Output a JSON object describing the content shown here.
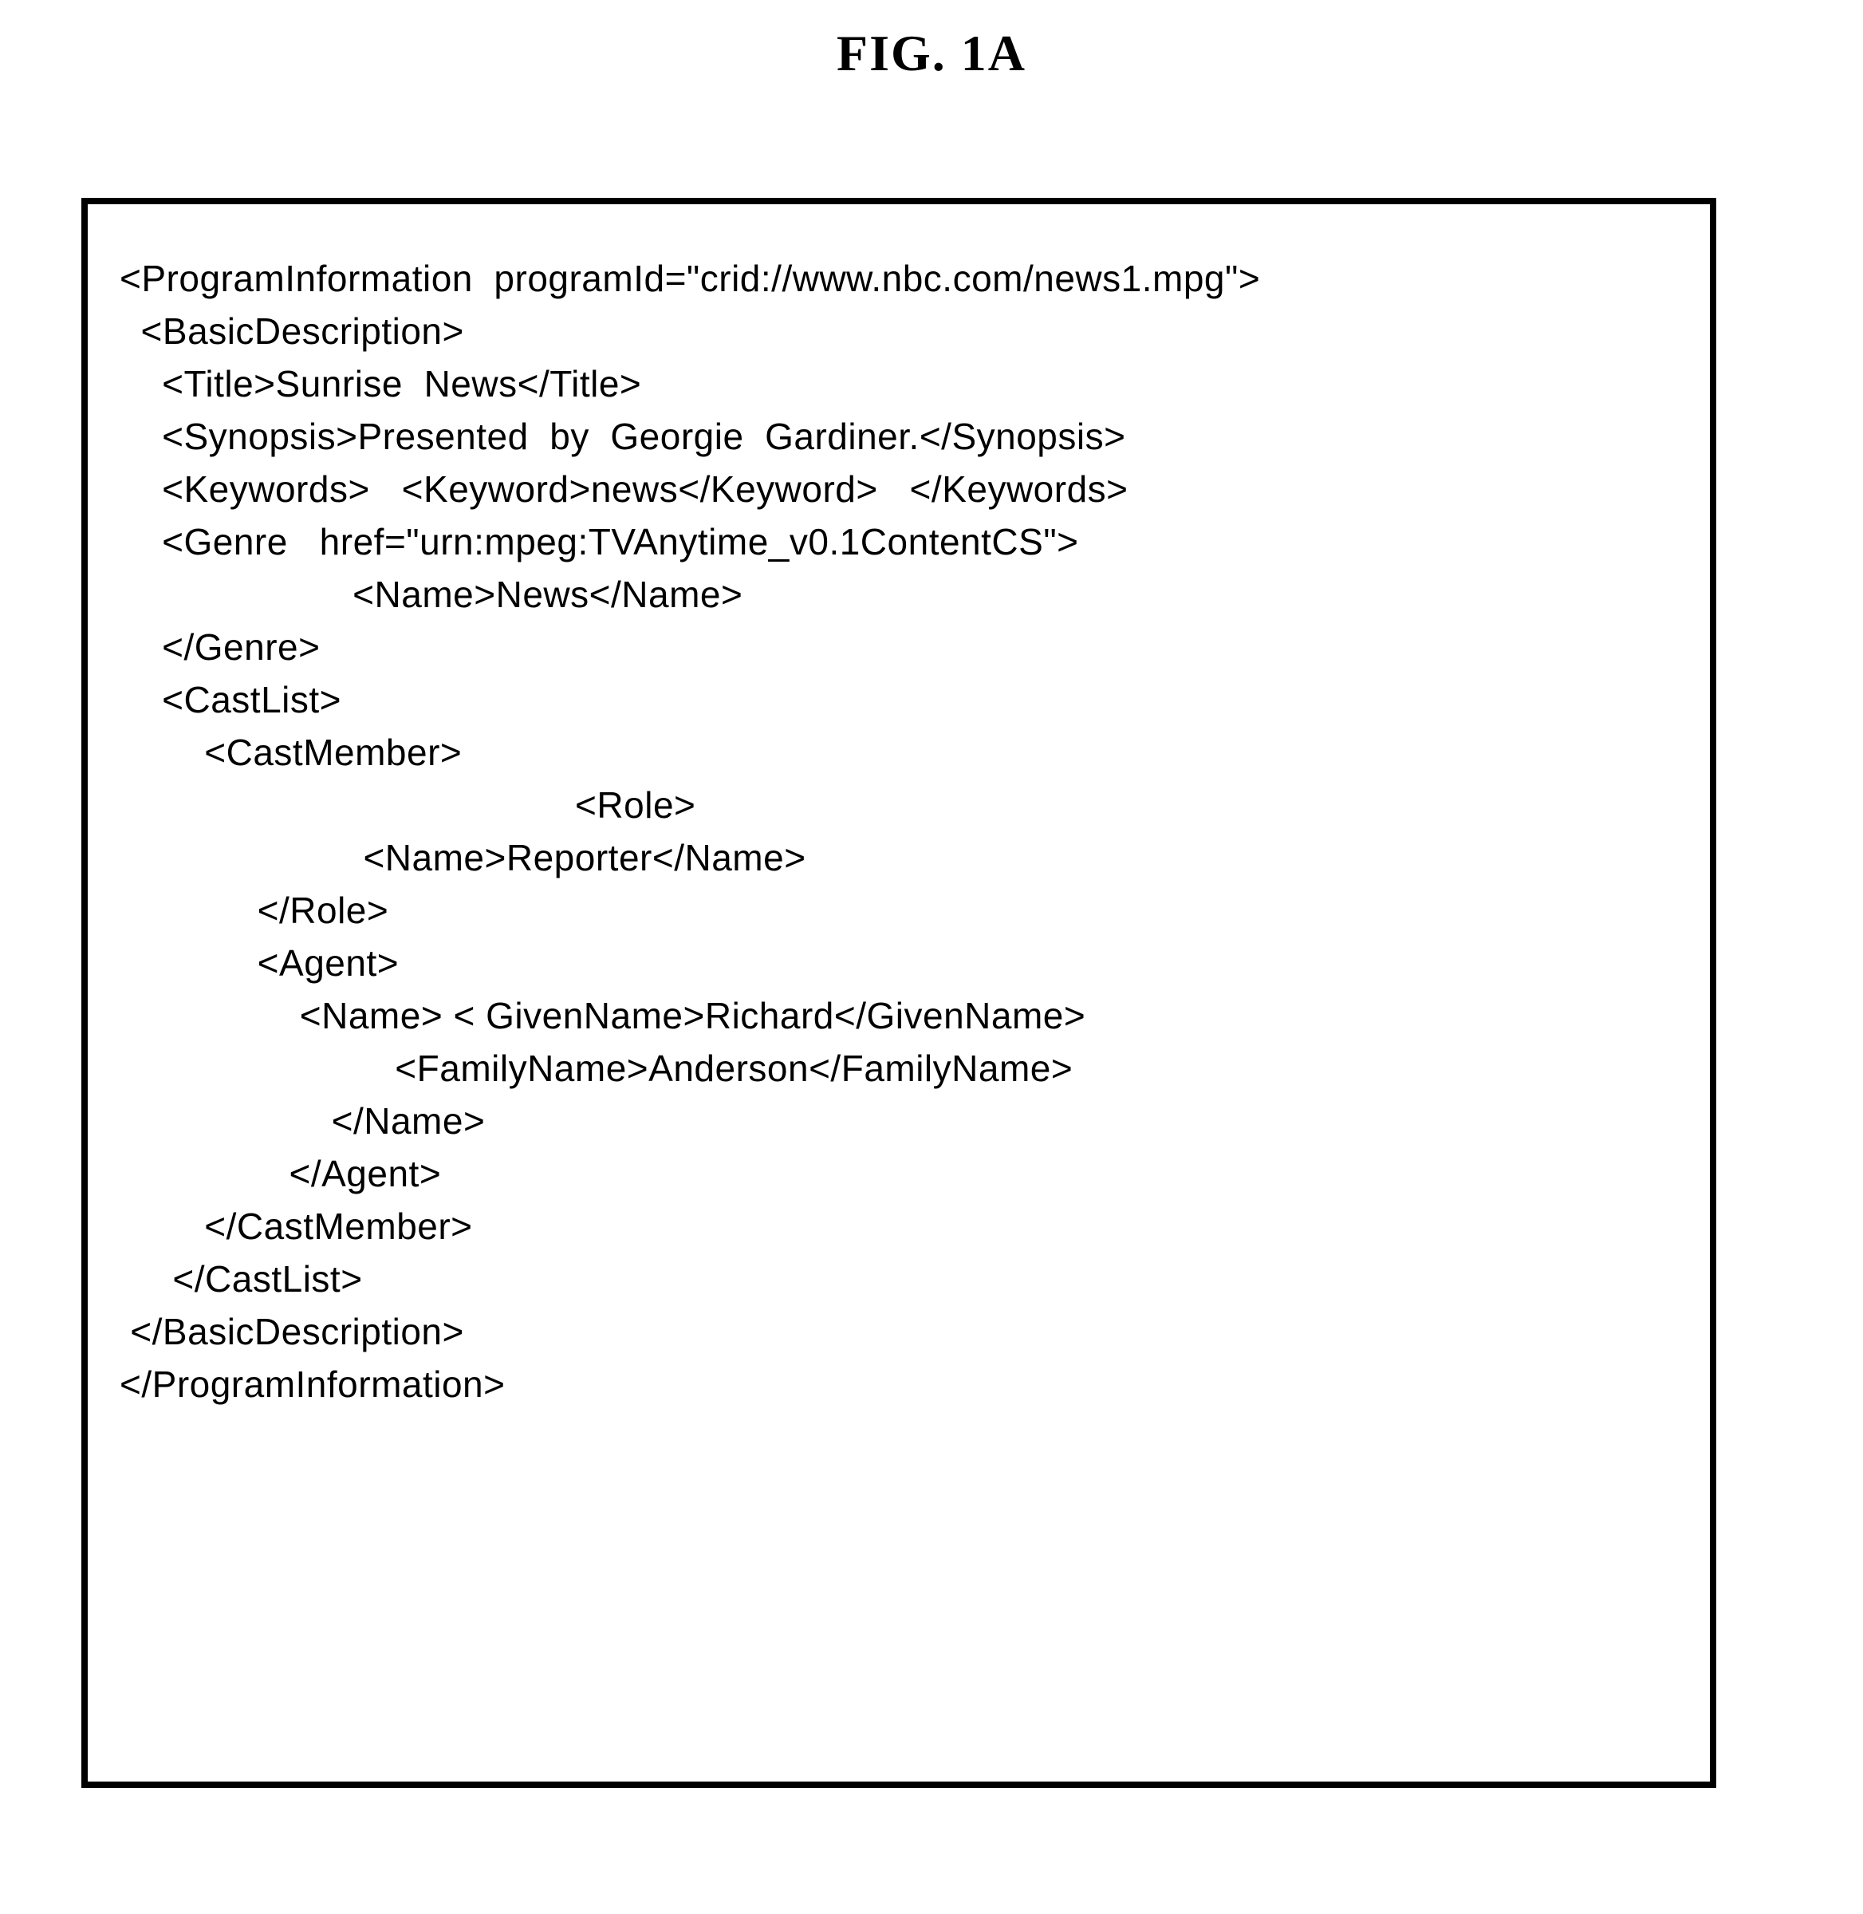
{
  "figure_label": "FIG.  1A",
  "code_lines": [
    "<ProgramInformation  programId=\"crid://www.nbc.com/news1.mpg\">",
    "  <BasicDescription>",
    "    <Title>Sunrise  News</Title>",
    "    <Synopsis>Presented  by  Georgie  Gardiner.</Synopsis>",
    "    <Keywords>   <Keyword>news</Keyword>   </Keywords>",
    "    <Genre   href=\"urn:mpeg:TVAnytime_v0.1ContentCS\">",
    "                      <Name>News</Name>",
    "    </Genre>",
    "    <CastList>",
    "        <CastMember>",
    "                                           <Role>",
    "                       <Name>Reporter</Name>",
    "             </Role>",
    "             <Agent>",
    "                 <Name> < GivenName>Richard</GivenName>",
    "                          <FamilyName>Anderson</FamilyName>",
    "                    </Name>",
    "                </Agent>",
    "        </CastMember>",
    "     </CastList>",
    " </BasicDescription>",
    "</ProgramInformation>"
  ]
}
